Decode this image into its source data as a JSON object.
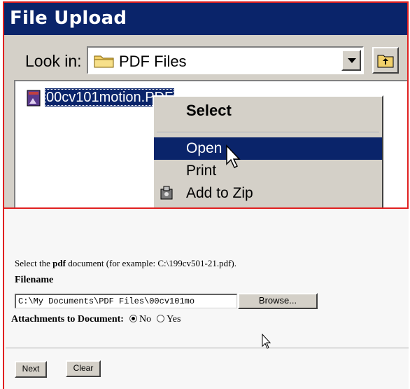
{
  "dialog": {
    "title": "File Upload",
    "look_in_label": "Look in:",
    "look_in_value": "PDF Files",
    "file_name": "00cv101motion.PDF",
    "context_menu": [
      {
        "label": "Select",
        "bold": true,
        "highlighted": false
      },
      {
        "label": "Open",
        "bold": false,
        "highlighted": true
      },
      {
        "label": "Print",
        "bold": false,
        "highlighted": false
      },
      {
        "label": "Add to Zip",
        "bold": false,
        "highlighted": false,
        "icon": "zip-icon"
      }
    ]
  },
  "form": {
    "instruction_prefix": "Select the ",
    "instruction_bold": "pdf",
    "instruction_suffix": " document (for example: C:\\199cv501-21.pdf).",
    "filename_label": "Filename",
    "filename_value": "C:\\My Documents\\PDF Files\\00cv101mo",
    "browse_label": "Browse...",
    "attachments_label": "Attachments to Document:",
    "option_no": "No",
    "option_yes": "Yes",
    "selected_option": "No",
    "next_label": "Next",
    "clear_label": "Clear"
  },
  "colors": {
    "titlebar": "#0a246a",
    "selection": "#0a246a",
    "frame_border": "#e02020",
    "dialog_bg": "#d4d0c8"
  }
}
